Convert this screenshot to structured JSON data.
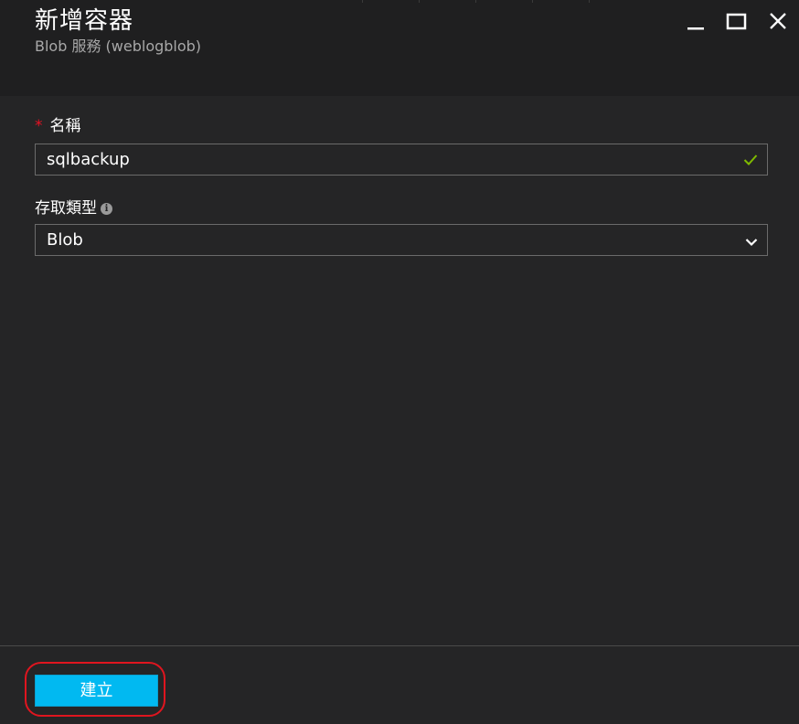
{
  "panel": {
    "title": "新增容器",
    "subtitle": "Blob 服務 (weblogblob)"
  },
  "window_controls": {
    "minimize_icon": "minimize-icon",
    "maximize_icon": "maximize-icon",
    "close_icon": "close-icon"
  },
  "form": {
    "name": {
      "required_marker": "*",
      "label": "名稱",
      "value": "sqlbackup",
      "status_icon": "checkmark-icon",
      "status_color": "#7fba00"
    },
    "access_type": {
      "label": "存取類型",
      "info_icon": "info-icon",
      "info_glyph": "i",
      "selected": "Blob",
      "dropdown_icon": "chevron-down-icon"
    }
  },
  "footer": {
    "create_label": "建立",
    "accent_color": "#01b9f1",
    "annotation_color": "#e0151f"
  }
}
